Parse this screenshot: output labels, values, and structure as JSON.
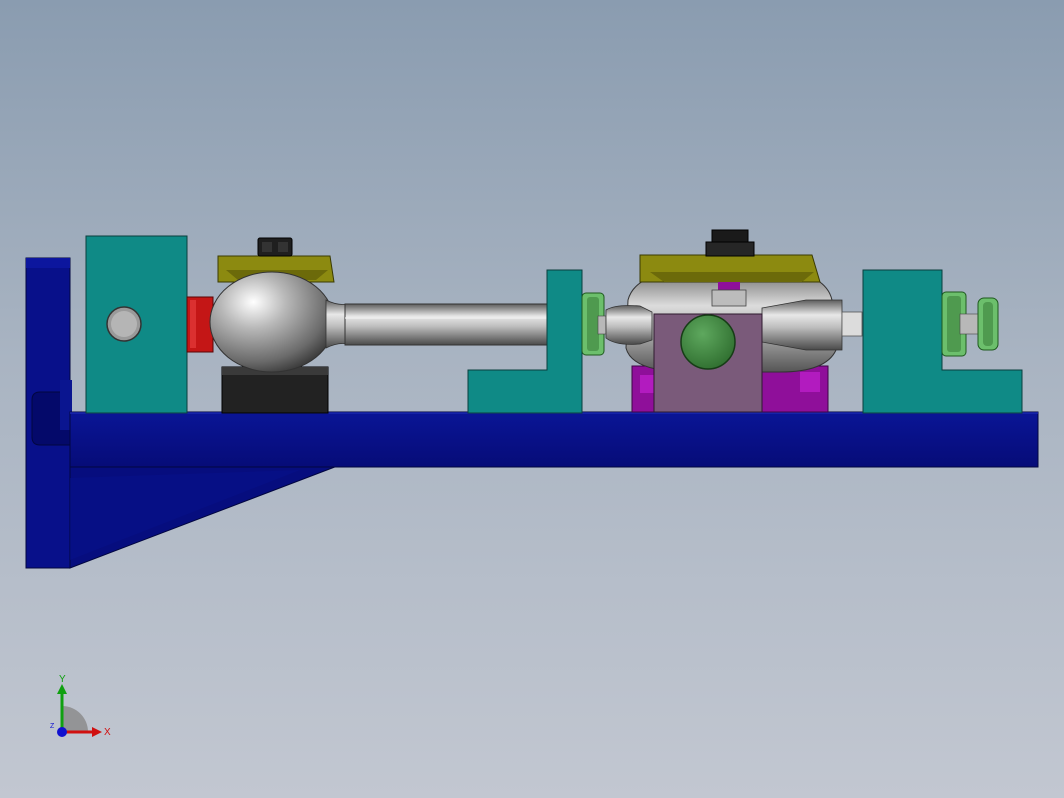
{
  "viewport": {
    "background_top": "#8a9cb0",
    "background_bottom": "#c2c7d1"
  },
  "model": {
    "colors": {
      "base": "#08108a",
      "base_dark": "#030760",
      "support_block": "#0f8a86",
      "clamp_pad": "#8c8a10",
      "black_part": "#202020",
      "steel": "#a9a9a9",
      "red_part": "#c41616",
      "green_knob": "#4f9a4f",
      "pink_block": "#7a5a7a",
      "magenta_part": "#8f0f9a"
    }
  },
  "triad": {
    "x_label": "X",
    "y_label": "Y",
    "z_label": "Z",
    "x_color": "#d01010",
    "y_color": "#10a010",
    "z_color": "#1010d0"
  }
}
